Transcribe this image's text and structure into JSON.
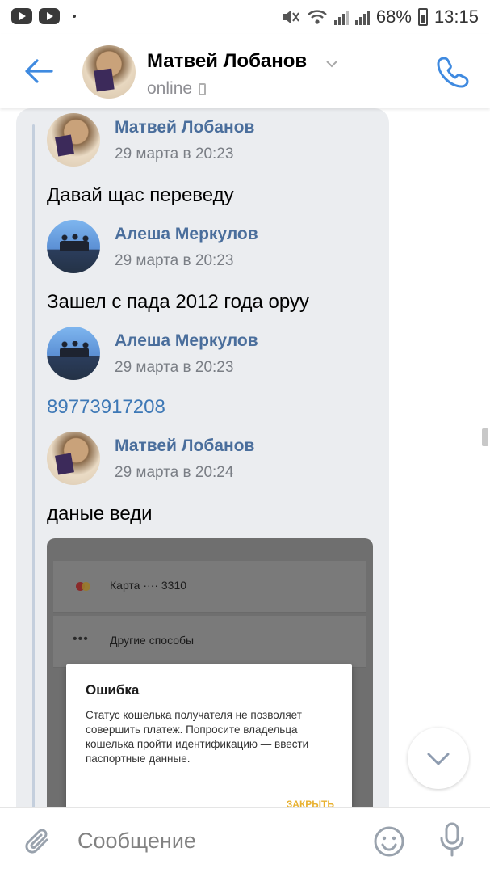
{
  "status_bar": {
    "battery": "68%",
    "time": "13:15"
  },
  "header": {
    "title": "Матвей Лобанов",
    "status": "online",
    "icons": [
      "back-arrow-icon",
      "chevron-down-icon",
      "mobile-phone-icon",
      "phone-call-icon"
    ]
  },
  "colors": {
    "accent": "#4a6e9c",
    "link": "#3d78b6",
    "bubble": "#ebedf0",
    "dialog_button": "#e8b130"
  },
  "messages": [
    {
      "author": "Матвей Лобанов",
      "time": "29 марта в 20:23",
      "text": "Давай щас переведу"
    },
    {
      "author": "Алеша Меркулов",
      "time": "29 марта в 20:23",
      "text": "Зашел с пада 2012 года оруу"
    },
    {
      "author": "Алеша Меркулов",
      "time": "29 марта в 20:23",
      "text": "89773917208"
    },
    {
      "author": "Матвей Лобанов",
      "time": "29 марта в 20:24",
      "text": "даные веди"
    }
  ],
  "attachment": {
    "card_label": "Карта ···· 3310",
    "other_label": "Другие способы",
    "dialog": {
      "title": "Ошибка",
      "body": "Статус кошелька получателя не позволяет совершить платеж. Попросите владельца кошелька пройти идентификацию — ввести паспортные данные.",
      "button": "ЗАКРЫТЬ"
    }
  },
  "composer": {
    "placeholder": "Сообщение",
    "icons": [
      "paperclip-icon",
      "emoji-icon",
      "microphone-icon"
    ]
  }
}
